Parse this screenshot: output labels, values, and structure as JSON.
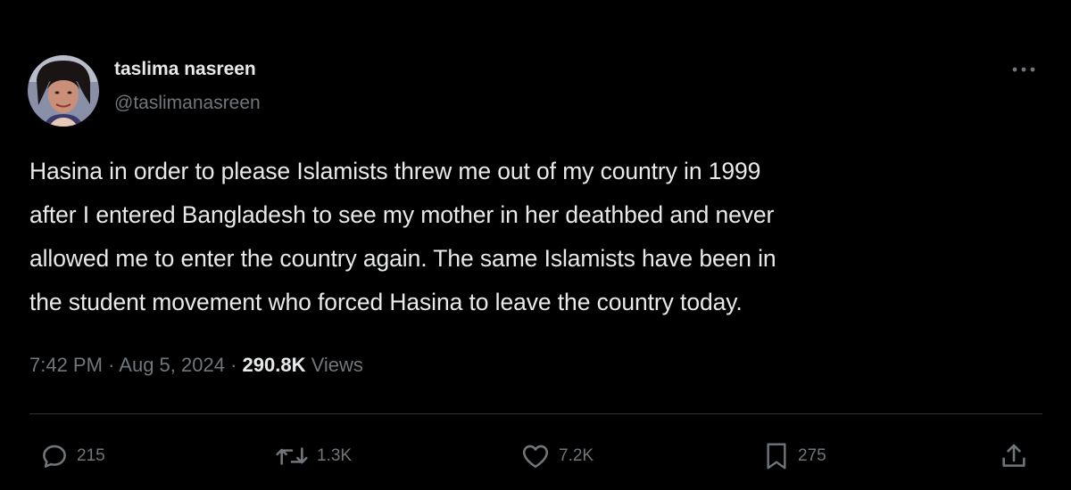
{
  "author": {
    "display_name": "taslima nasreen",
    "handle": "@taslimanasreen",
    "avatar_icon": "profile-photo"
  },
  "tweet": {
    "lines": [
      "Hasina in order to please Islamists threw me out of my country in 1999",
      "after I entered Bangladesh to see my mother in her deathbed and never",
      "allowed me to enter the country again. The same Islamists have been in",
      "the student movement who forced Hasina to leave the country today."
    ]
  },
  "meta": {
    "time": "7:42 PM",
    "separator": "·",
    "date": "Aug 5, 2024",
    "views_count": "290.8K",
    "views_label": "Views"
  },
  "actions": {
    "reply": {
      "icon": "reply-icon",
      "count": "215"
    },
    "retweet": {
      "icon": "retweet-icon",
      "count": "1.3K"
    },
    "like": {
      "icon": "heart-icon",
      "count": "7.2K"
    },
    "bookmark": {
      "icon": "bookmark-icon",
      "count": "275"
    },
    "share": {
      "icon": "share-icon"
    }
  },
  "colors": {
    "background": "#000000",
    "text_primary": "#e7e9ea",
    "text_secondary": "#71767b",
    "divider": "#2f3336"
  }
}
